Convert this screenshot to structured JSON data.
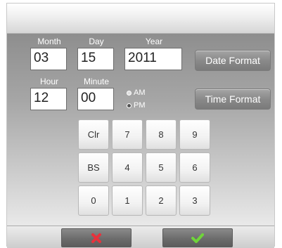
{
  "labels": {
    "month": "Month",
    "day": "Day",
    "year": "Year",
    "hour": "Hour",
    "minute": "Minute"
  },
  "fields": {
    "month": "03",
    "day": "15",
    "year": "2011",
    "hour": "12",
    "minute": "00"
  },
  "meridiem": {
    "am_label": "AM",
    "pm_label": "PM",
    "selected": "PM"
  },
  "buttons": {
    "date_format": "Date Format",
    "time_format": "Time Format"
  },
  "keypad": {
    "row1": [
      "Clr",
      "7",
      "8",
      "9"
    ],
    "row2": [
      "BS",
      "4",
      "5",
      "6"
    ],
    "row3": [
      "0",
      "1",
      "2",
      "3"
    ]
  },
  "footer": {
    "cancel_icon": "red-x-icon",
    "confirm_icon": "green-checkmark-icon"
  },
  "colors": {
    "cancel": "#e8323c",
    "confirm": "#6fd43a"
  }
}
